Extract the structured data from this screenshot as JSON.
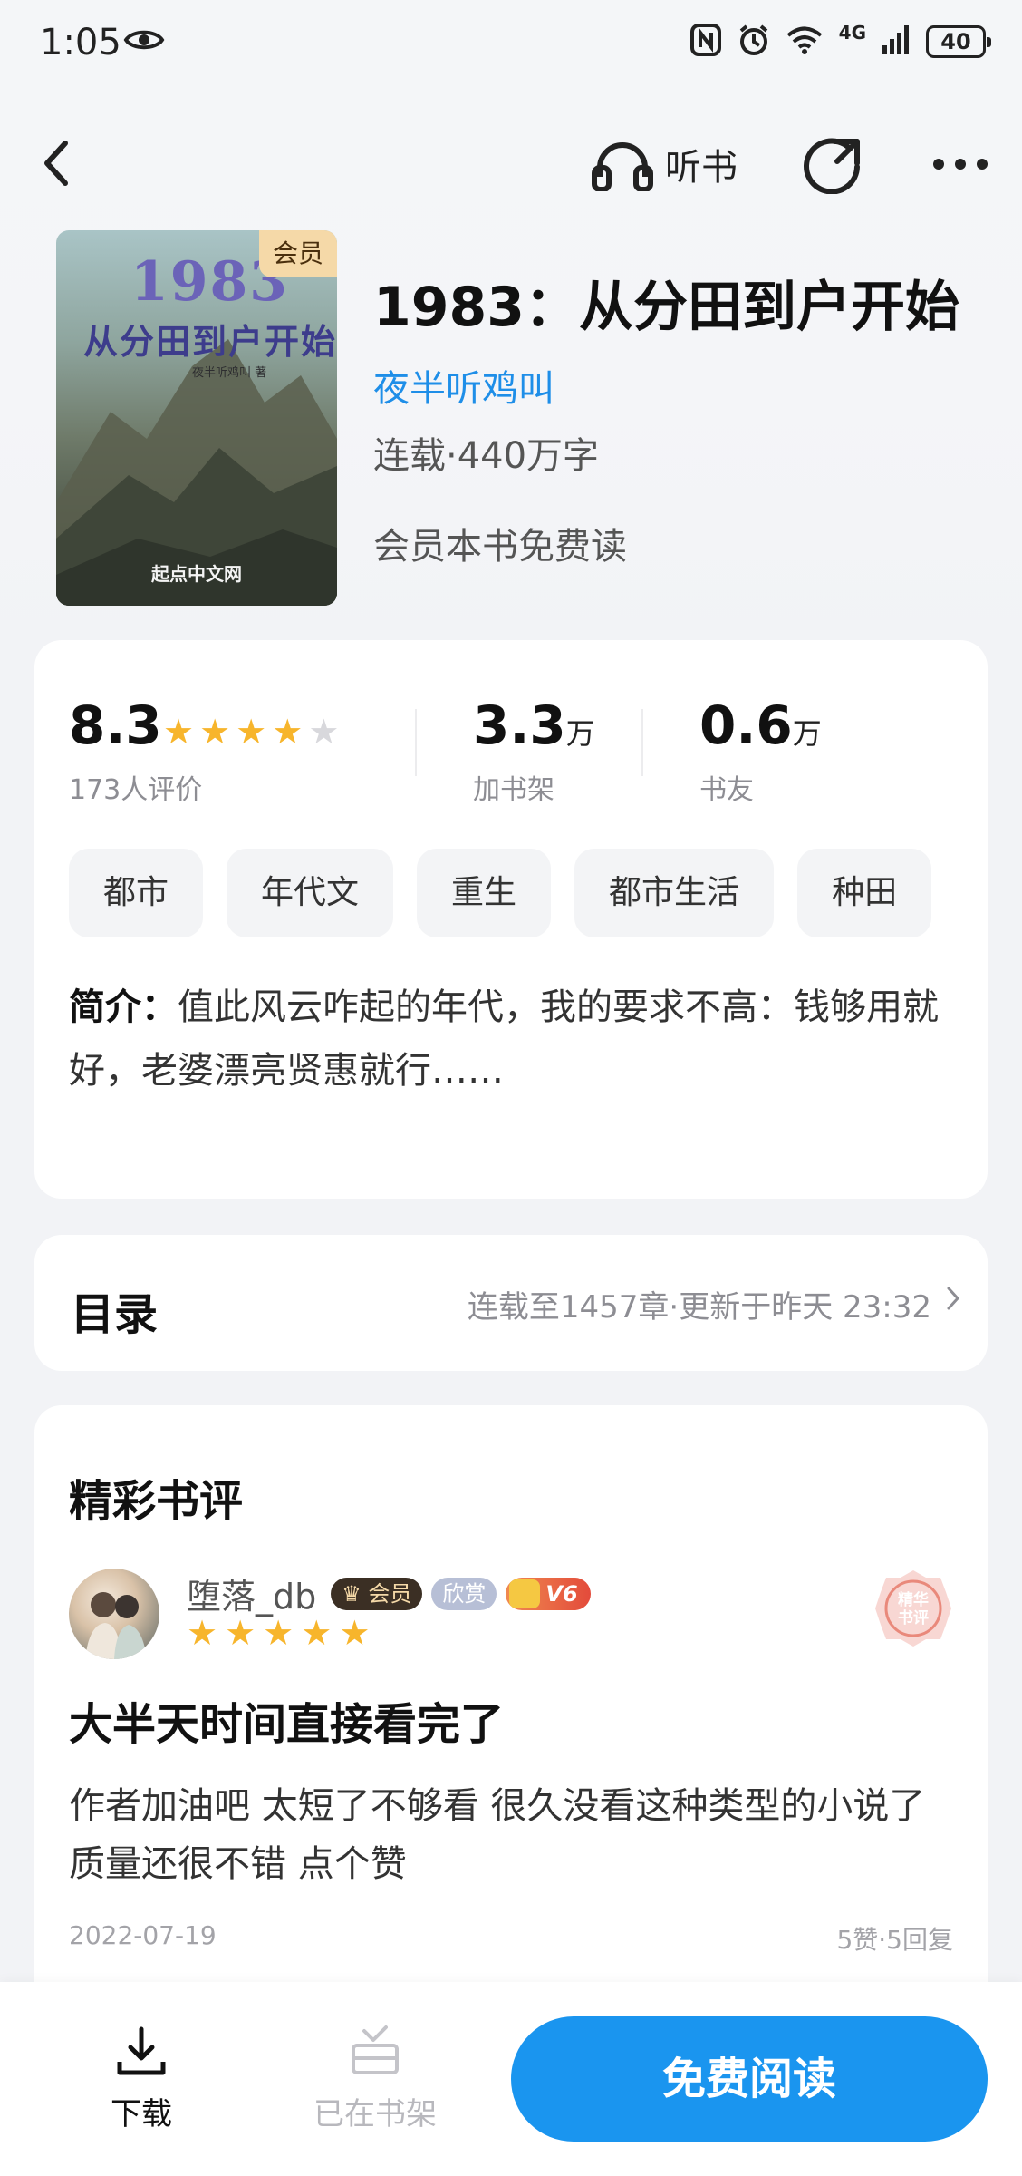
{
  "status_bar": {
    "time": "1:05",
    "network": "4G",
    "battery": "40"
  },
  "nav": {
    "listen_label": "听书"
  },
  "book": {
    "title": "1983：从分田到户开始",
    "author": "夜半听鸡叫",
    "meta": "连载·440万字",
    "member_note": "会员本书免费读",
    "cover": {
      "badge": "会员",
      "title_number": "1983",
      "title_text": "从分田到户开始",
      "author_small": "夜半听鸡叫 著",
      "publisher": "起点中文网"
    }
  },
  "stats": {
    "rating": "8.3",
    "rating_stars": 4,
    "rating_count_label": "173人评价",
    "shelf_value": "3.3",
    "shelf_unit": "万",
    "shelf_label": "加书架",
    "fans_value": "0.6",
    "fans_unit": "万",
    "fans_label": "书友"
  },
  "tags": [
    "都市",
    "年代文",
    "重生",
    "都市生活",
    "种田"
  ],
  "intro": {
    "label": "简介：",
    "text": "值此风云咋起的年代，我的要求不高：钱够用就好，老婆漂亮贤惠就行……"
  },
  "toc": {
    "title": "目录",
    "info": "连载至1457章·更新于昨天 23:32"
  },
  "review_section": {
    "heading": "精彩书评",
    "reviewer": "堕落_db",
    "badge_member": "会员",
    "badge_appreciate": "欣赏",
    "badge_level": "V6",
    "stars": 5,
    "stamp": "精华书评",
    "title": "大半天时间直接看完了",
    "body": "作者加油吧 太短了不够看 很久没看这种类型的小说了质量还很不错 点个赞",
    "date": "2022-07-19",
    "stats": "5赞·5回复"
  },
  "bottom_bar": {
    "download_label": "下载",
    "shelf_label": "已在书架",
    "read_label": "免费阅读"
  },
  "colors": {
    "accent": "#1a95ef",
    "author_link": "#1e8ee8",
    "star": "#f7b52c",
    "star_empty": "#d8d8dc"
  }
}
